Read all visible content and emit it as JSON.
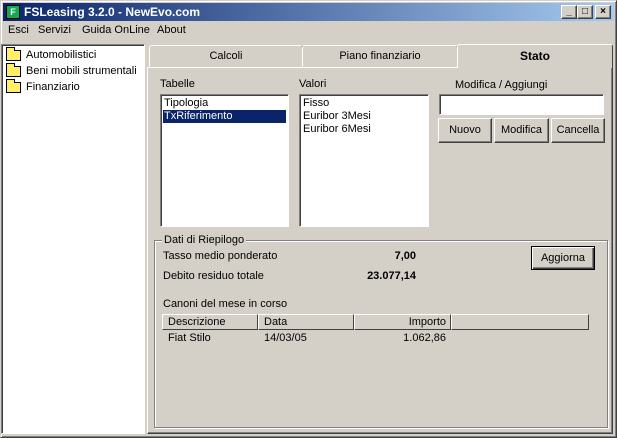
{
  "window": {
    "title": "FSLeasing 3.2.0 - NewEvo.com",
    "app_icon": "fs-app-icon",
    "controls": {
      "minimize": "_",
      "maximize": "□",
      "close": "×"
    }
  },
  "menu": [
    {
      "label": "Esci"
    },
    {
      "label": "Servizi"
    },
    {
      "label": "Guida OnLine"
    },
    {
      "label": "About"
    }
  ],
  "tree": [
    {
      "label": "Automobilistici",
      "icon": "folder-icon"
    },
    {
      "label": "Beni mobili strumentali",
      "icon": "folder-icon"
    },
    {
      "label": "Finanziario",
      "icon": "folder-icon"
    }
  ],
  "tabs": [
    {
      "label": "Calcoli",
      "active": false
    },
    {
      "label": "Piano finanziario",
      "active": false
    },
    {
      "label": "Stato",
      "active": true
    }
  ],
  "stato": {
    "tabelle_label": "Tabelle",
    "tabelle_items": [
      "Tipologia",
      "TxRiferimento"
    ],
    "tabelle_selected": 1,
    "valori_label": "Valori",
    "valori_items": [
      "Fisso",
      "Euribor 3Mesi",
      "Euribor 6Mesi"
    ],
    "modifica_label": "Modifica / Aggiungi",
    "modifica_value": "",
    "buttons": {
      "nuovo": "Nuovo",
      "modifica": "Modifica",
      "cancella": "Cancella"
    },
    "riepilogo": {
      "title": "Dati di Riepilogo",
      "tasso_label": "Tasso medio ponderato",
      "tasso_value": "7,00",
      "debito_label": "Debito residuo totale",
      "debito_value": "23.077,14",
      "aggiorna": "Aggiorna",
      "canoni_label": "Canoni del mese in corso",
      "columns": [
        "Descrizione",
        "Data",
        "Importo"
      ],
      "rows": [
        {
          "descrizione": "Fiat Stilo",
          "data": "14/03/05",
          "importo": "1.062,86"
        }
      ]
    }
  }
}
